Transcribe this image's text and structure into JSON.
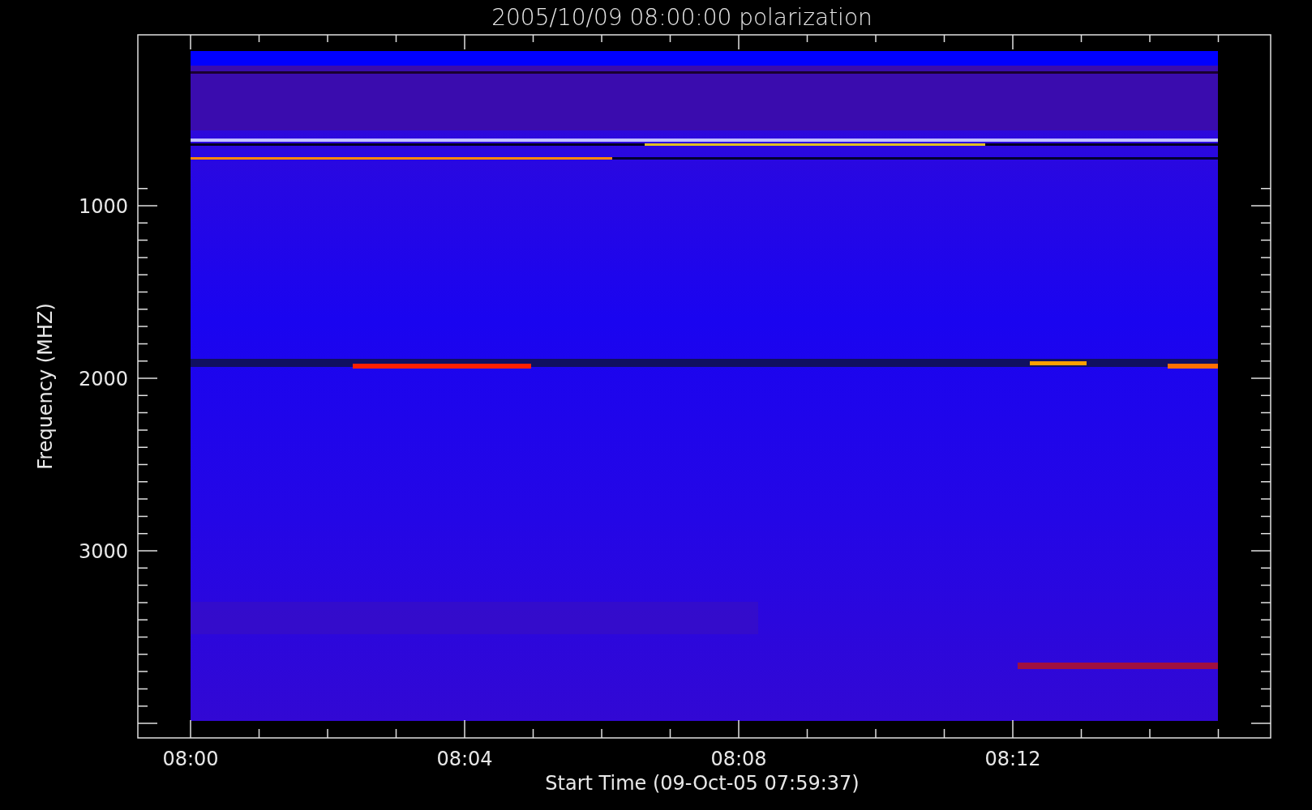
{
  "title": "2005/10/09 08:00:00 polarization",
  "y_axis": {
    "label": "Frequency (MHZ)",
    "ticks": [
      "1000",
      "2000",
      "3000"
    ]
  },
  "x_axis": {
    "label": "Start Time (09-Oct-05 07:59:37)",
    "ticks": [
      "08:00",
      "08:04",
      "08:08",
      "08:12"
    ]
  }
}
